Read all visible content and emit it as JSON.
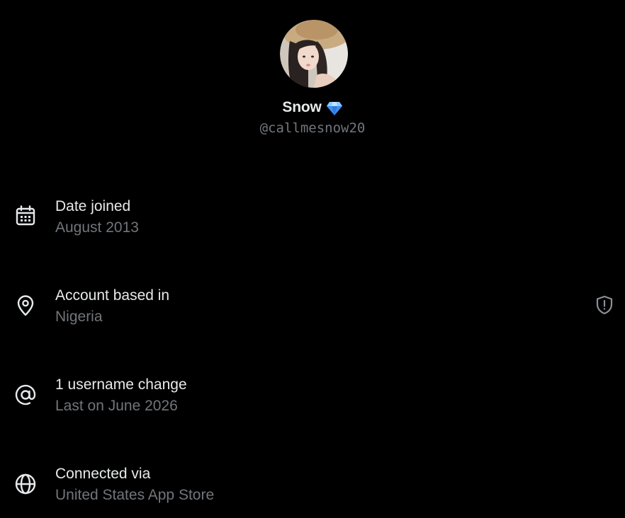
{
  "profile": {
    "display_name": "Snow",
    "badge_icon": "gem-icon",
    "handle": "@callmesnow20"
  },
  "rows": [
    {
      "icon": "calendar-icon",
      "label": "Date joined",
      "value": "August 2013"
    },
    {
      "icon": "location-pin-icon",
      "label": "Account based in",
      "value": "Nigeria",
      "extra_icon": "shield-alert-icon"
    },
    {
      "icon": "at-sign-icon",
      "label": "1 username change",
      "value": "Last on June 2026"
    },
    {
      "icon": "globe-icon",
      "label": "Connected via",
      "value": "United States App Store"
    }
  ],
  "colors": {
    "background": "#000000",
    "primary_text": "#e7e9ea",
    "secondary_text": "#71767b",
    "badge": "#4aa3ff"
  }
}
